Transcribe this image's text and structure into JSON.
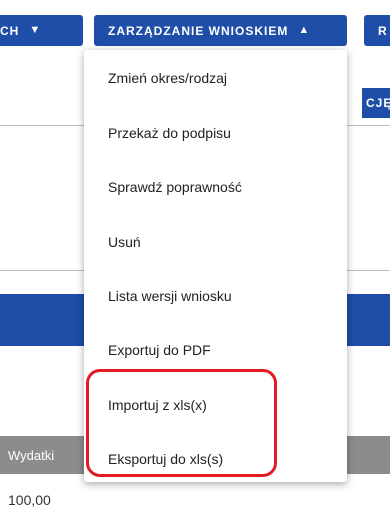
{
  "toolbar": {
    "left_button_label": "CH",
    "manage_button_label": "ZARZĄDZANIE WNIOSKIEM",
    "right_button_label": "R",
    "secondary_right_label": "CJĘ"
  },
  "menu": {
    "items": [
      "Zmień okres/rodzaj",
      "Przekaż do podpisu",
      "Sprawdź poprawność",
      "Usuń",
      "Lista wersji wniosku",
      "Exportuj do PDF",
      "Importuj z xls(x)",
      "Eksportuj do xls(s)"
    ]
  },
  "table": {
    "header_label": "Wydatki",
    "value": "100,00"
  },
  "colors": {
    "primary": "#1f4ea8",
    "highlight": "#e31b23",
    "header_gray": "#8c8c8c"
  }
}
